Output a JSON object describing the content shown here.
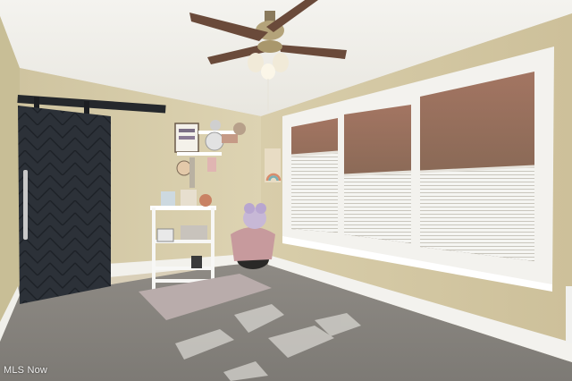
{
  "photo": {
    "description_tag": "room-interior",
    "watermark": "MLS Now"
  },
  "colors": {
    "ceiling": "#f1f0ec",
    "wall_back": "#d8cda9",
    "wall_right": "#d3c7a2",
    "wall_left": "#c9bf97",
    "carpet": "#8e8a84",
    "trim": "#f4f3ef",
    "barn_door": "#2c3138",
    "rug": "#b7a9a8",
    "fan_blade": "#6a4a3a"
  }
}
